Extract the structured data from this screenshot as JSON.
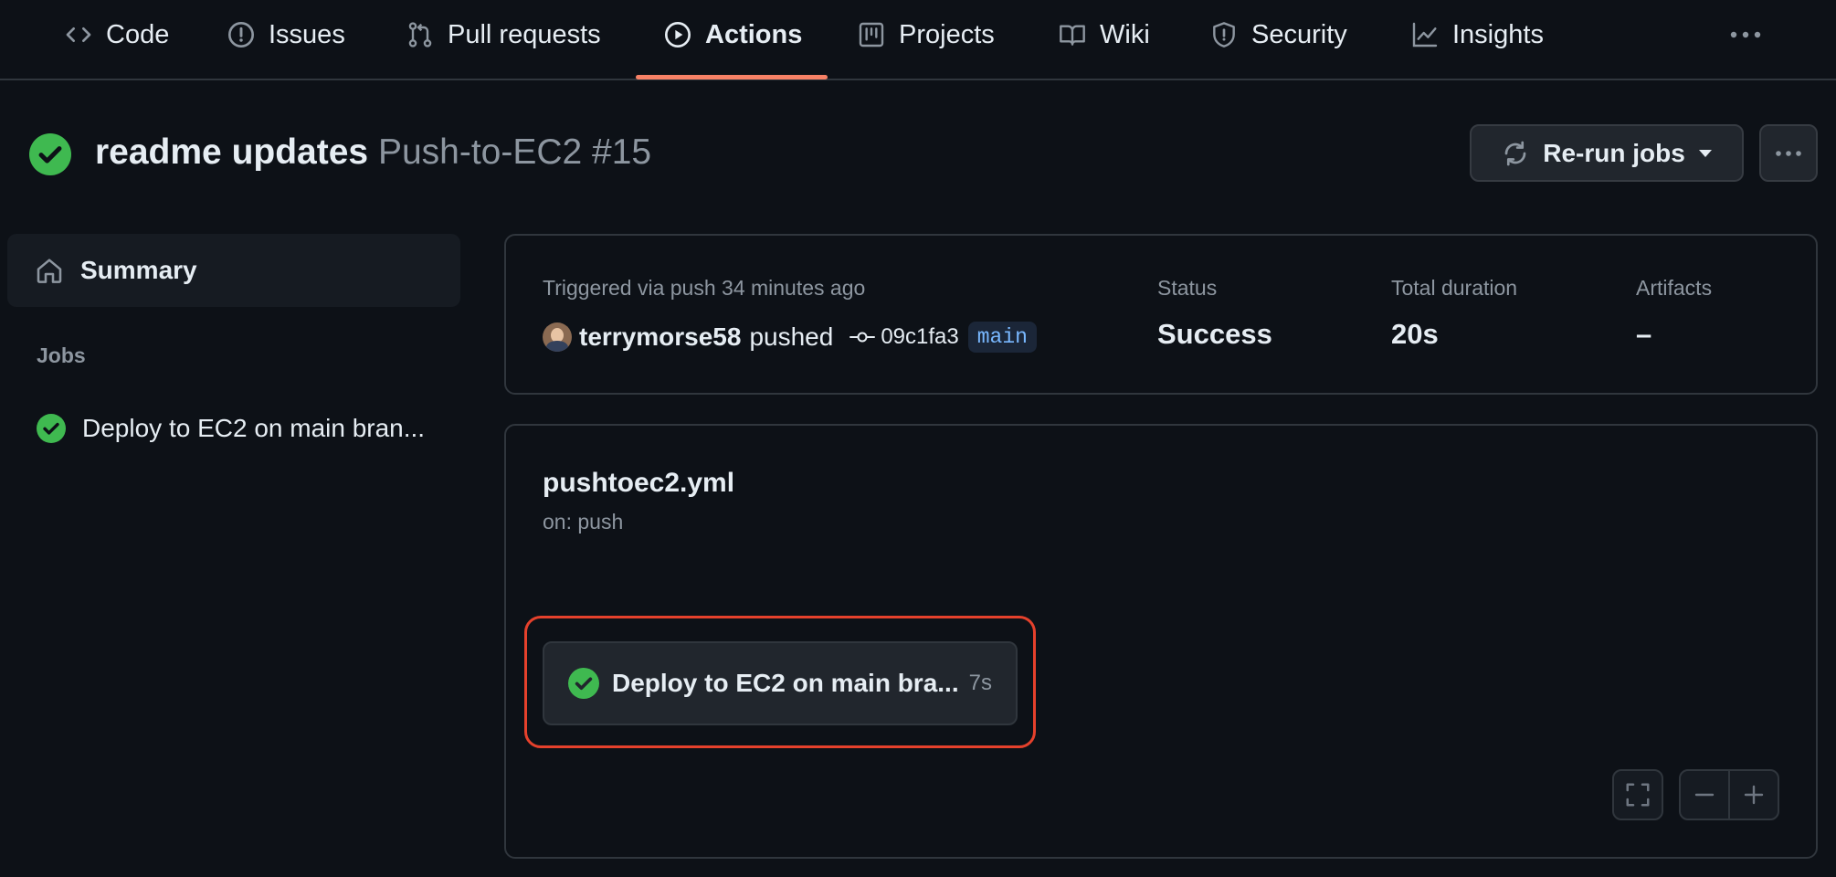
{
  "nav": {
    "tabs": [
      {
        "label": "Code",
        "icon": "code-icon"
      },
      {
        "label": "Issues",
        "icon": "issue-icon"
      },
      {
        "label": "Pull requests",
        "icon": "pull-request-icon"
      },
      {
        "label": "Actions",
        "icon": "play-icon",
        "active": true
      },
      {
        "label": "Projects",
        "icon": "project-icon"
      },
      {
        "label": "Wiki",
        "icon": "book-icon"
      },
      {
        "label": "Security",
        "icon": "shield-icon"
      },
      {
        "label": "Insights",
        "icon": "graph-icon"
      }
    ],
    "more_icon": "kebab-horizontal-icon"
  },
  "header": {
    "title": "readme updates",
    "workflow_run": "Push-to-EC2 #15",
    "status_icon": "check-circle-fill-icon",
    "rerun_label": "Re-run jobs"
  },
  "sidebar": {
    "summary_label": "Summary",
    "jobs_heading": "Jobs",
    "jobs": [
      {
        "label": "Deploy to EC2 on main bran...",
        "status": "success"
      }
    ]
  },
  "summary": {
    "triggered": "Triggered via push 34 minutes ago",
    "actor": "terrymorse58",
    "action": "pushed",
    "commit_sha": "09c1fa3",
    "branch": "main",
    "status_label": "Status",
    "status_value": "Success",
    "duration_label": "Total duration",
    "duration_value": "20s",
    "artifacts_label": "Artifacts",
    "artifacts_value": "–"
  },
  "workflow": {
    "file": "pushtoec2.yml",
    "trigger": "on: push",
    "job": {
      "label": "Deploy to EC2 on main bra...",
      "duration": "7s"
    }
  },
  "colors": {
    "background": "#0d1117",
    "success": "#3fb950",
    "accent_underline": "#f78166",
    "highlight": "#e5412c"
  }
}
